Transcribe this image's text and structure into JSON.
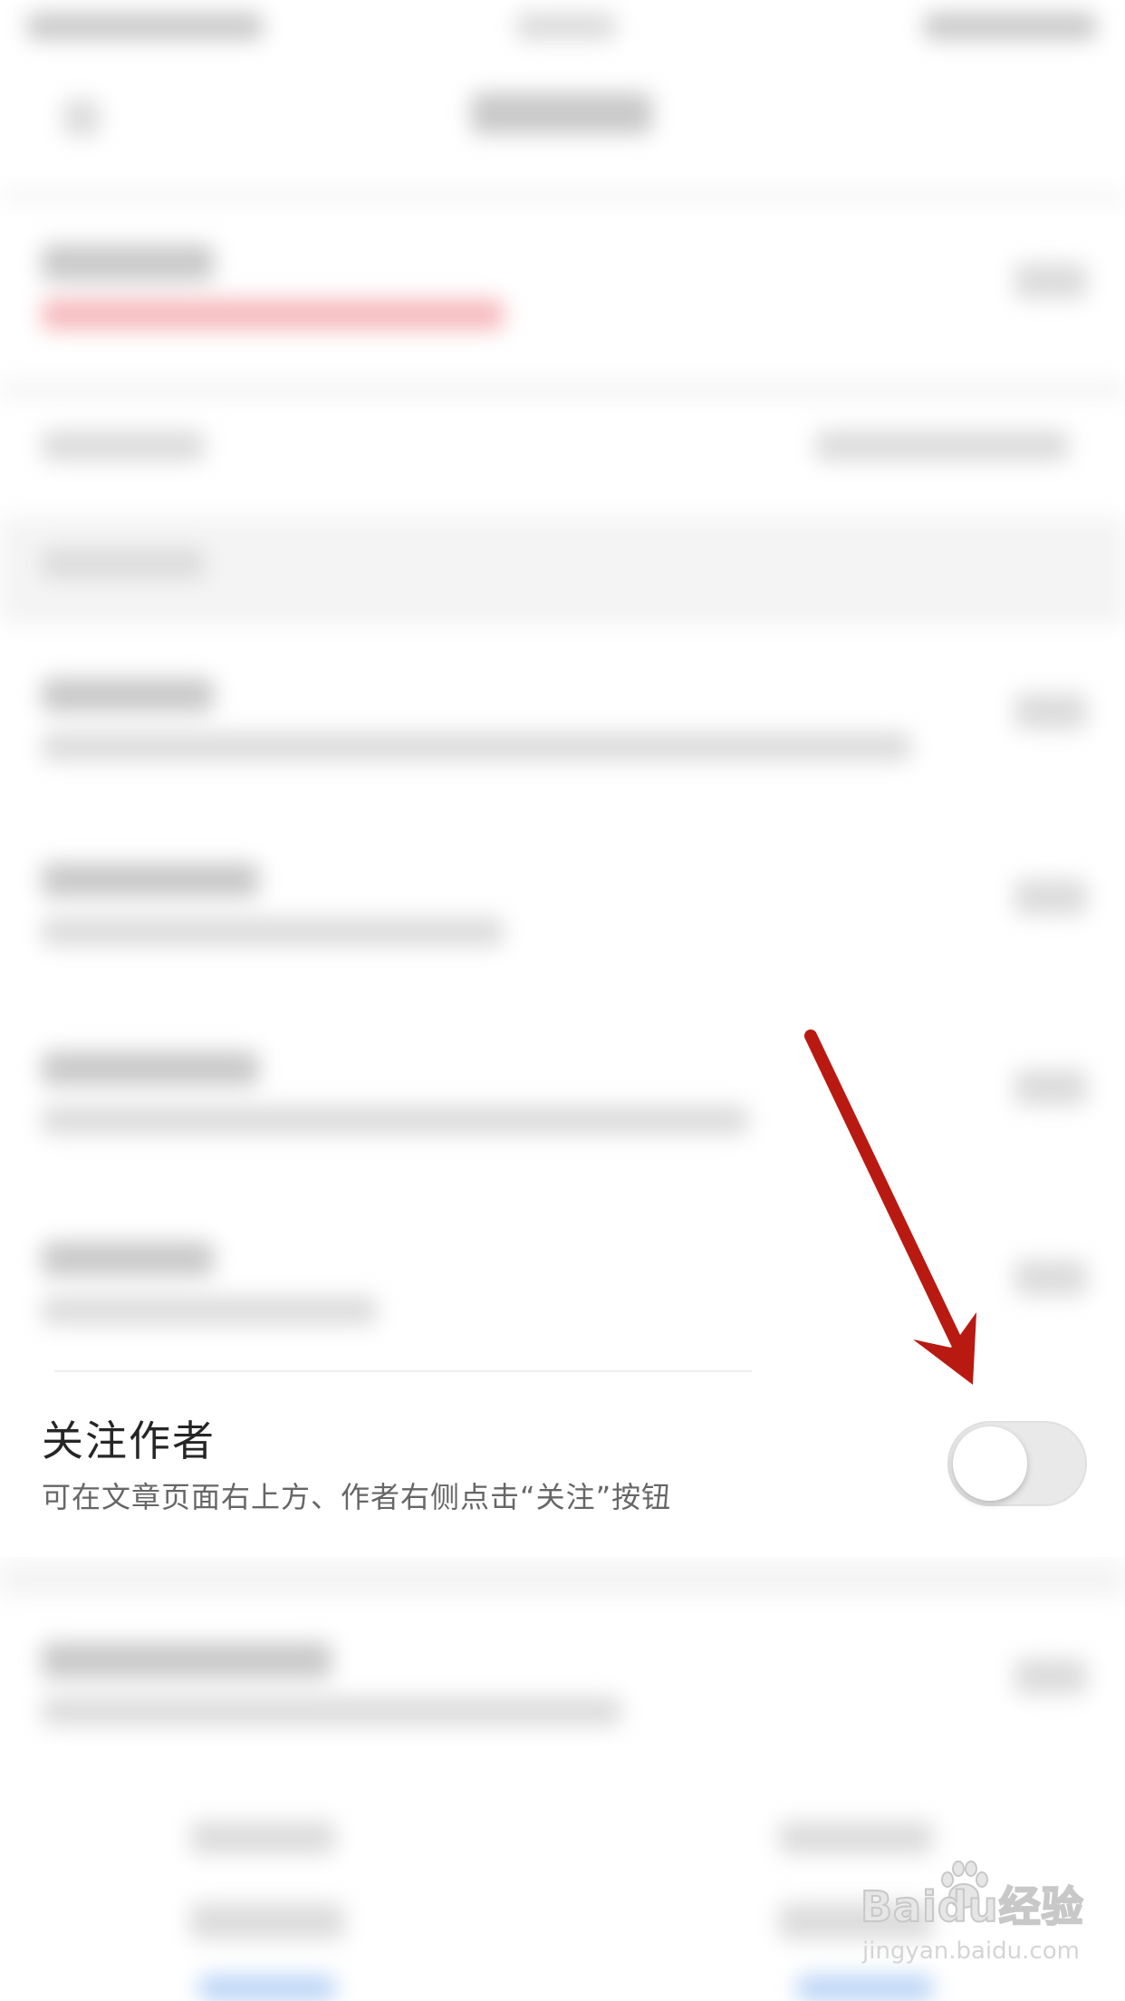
{
  "setting": {
    "title": "关注作者",
    "description": "可在文章页面右上方、作者右侧点击“关注”按钮",
    "toggle_on": false
  },
  "watermark": {
    "brand_prefix": "Bai",
    "brand_suffix": "经验",
    "brand_du": "du",
    "sub": "jingyan.baidu.com"
  },
  "colors": {
    "arrow": "#b81a12",
    "toggle_off_track": "#e9e9e9",
    "title": "#262626",
    "description": "#666666"
  },
  "icons": {
    "arrow": "red-arrow-icon",
    "paw": "baidu-paw-icon"
  }
}
